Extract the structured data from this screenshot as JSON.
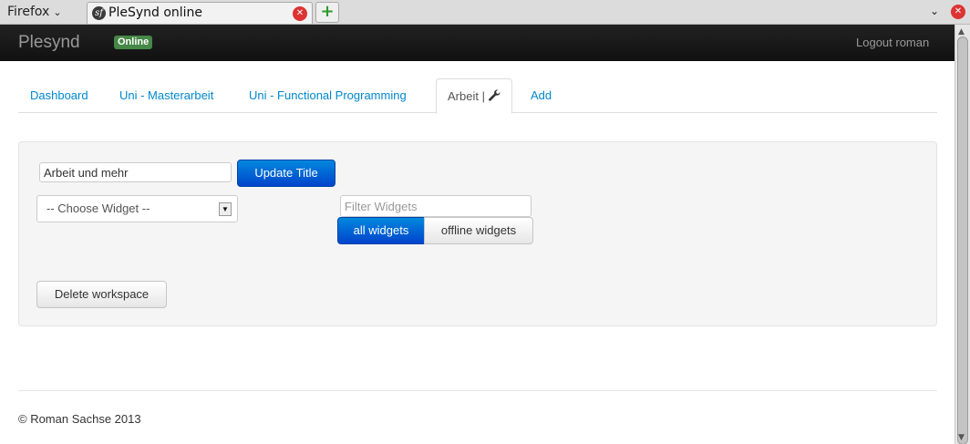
{
  "browser": {
    "menu_label": "Firefox",
    "menu_chevron": "⌄",
    "tab_title": "PleSynd online",
    "tab_favicon": "sf",
    "tab_close": "✕",
    "new_tab": "+",
    "list_all_tabs": "⌄",
    "window_close": "✕"
  },
  "navbar": {
    "brand": "Plesynd",
    "status": "Online",
    "logout": "Logout roman"
  },
  "tabs": [
    {
      "label": "Dashboard"
    },
    {
      "label": "Uni - Masterarbeit"
    },
    {
      "label": "Uni - Functional Programming"
    },
    {
      "label": "Arbeit |"
    },
    {
      "label": "Add"
    }
  ],
  "workspace": {
    "title_value": "Arbeit und mehr",
    "update_button": "Update Title",
    "choose_widget": "-- Choose Widget --",
    "filter_placeholder": "Filter Widgets",
    "all_widgets": "all widgets",
    "offline_widgets": "offline widgets",
    "delete_button": "Delete workspace"
  },
  "footer": {
    "copyright": "© Roman Sachse 2013"
  },
  "colors": {
    "accent": "#0088cc",
    "primary_button": "#0066cc",
    "status_badge": "#468847",
    "navbar": "#1b1b1b"
  }
}
